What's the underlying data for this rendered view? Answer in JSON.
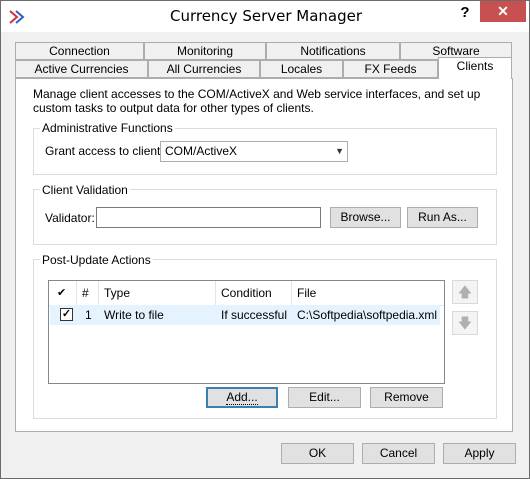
{
  "window": {
    "title": "Currency Server Manager",
    "help_symbol": "?",
    "close_symbol": "✕"
  },
  "tabs": {
    "row1": [
      "Connection",
      "Monitoring",
      "Notifications",
      "Software"
    ],
    "row2": [
      "Active Currencies",
      "All Currencies",
      "Locales",
      "FX Feeds",
      "Clients"
    ],
    "active": "Clients"
  },
  "description": "Manage client accesses to the COM/ActiveX and Web service interfaces, and set up custom tasks to output data for other types of clients.",
  "admin": {
    "title": "Administrative Functions",
    "grant_label": "Grant access to clients:",
    "grant_value": "COM/ActiveX"
  },
  "validation": {
    "title": "Client Validation",
    "validator_label": "Validator:",
    "validator_value": "",
    "browse_label": "Browse...",
    "run_as_label": "Run As..."
  },
  "post_update": {
    "title": "Post-Update Actions",
    "columns": [
      "✔",
      "#",
      "Type",
      "Condition",
      "File"
    ],
    "rows": [
      {
        "checked": true,
        "num": "1",
        "type": "Write to file",
        "condition": "If successful",
        "file": "C:\\Softpedia\\softpedia.xml"
      }
    ],
    "add_label": "Add...",
    "edit_label": "Edit...",
    "remove_label": "Remove"
  },
  "footer": {
    "ok_label": "OK",
    "cancel_label": "Cancel",
    "apply_label": "Apply"
  },
  "colors": {
    "close_button": "#c75050",
    "default_button_border": "#3c7fb1",
    "selected_row": "#e5f3ff"
  }
}
